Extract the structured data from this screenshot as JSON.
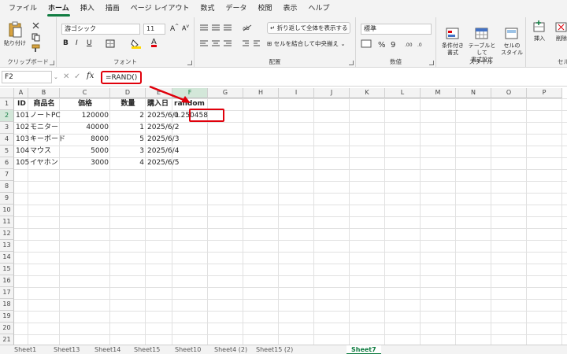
{
  "menu": [
    "ファイル",
    "ホーム",
    "挿入",
    "描画",
    "ページ レイアウト",
    "数式",
    "データ",
    "校閲",
    "表示",
    "ヘルプ"
  ],
  "ribbon": {
    "clipboard": {
      "paste_label": "貼り付け",
      "group_label": "クリップボード"
    },
    "font": {
      "font_name": "游ゴシック",
      "font_size": "11",
      "group_label": "フォント"
    },
    "alignment": {
      "wrap_label": "折り返して全体を表示する",
      "merge_label": "セルを結合して中央揃え",
      "group_label": "配置"
    },
    "number": {
      "format": "標準",
      "group_label": "数値"
    },
    "styles": {
      "cond_label": "条件付き\n書式",
      "table_label": "テーブルとして\n書式設定",
      "cell_label": "セルの\nスタイル",
      "group_label": "スタイル"
    },
    "cells": {
      "insert_label": "挿入",
      "delete_label": "削除",
      "group_label": "セル"
    }
  },
  "formula_bar": {
    "name_box": "F2",
    "fx": "fx",
    "formula": "=RAND()"
  },
  "columns": [
    "A",
    "B",
    "C",
    "D",
    "E",
    "F",
    "G",
    "H",
    "I",
    "J",
    "K",
    "L",
    "M",
    "N",
    "O",
    "P"
  ],
  "row_numbers": [
    "1",
    "2",
    "3",
    "4",
    "5",
    "6",
    "7",
    "8",
    "9",
    "10",
    "11",
    "12",
    "13",
    "14",
    "15",
    "16",
    "17",
    "18",
    "19",
    "20",
    "21"
  ],
  "table": {
    "headers": [
      "ID",
      "商品名",
      "価格",
      "数量",
      "購入日",
      "random"
    ],
    "rows": [
      [
        "101",
        "ノートPC",
        "120000",
        "2",
        "2025/6/1",
        "0.250458"
      ],
      [
        "102",
        "モニター",
        "40000",
        "1",
        "2025/6/2",
        ""
      ],
      [
        "103",
        "キーボード",
        "8000",
        "5",
        "2025/6/3",
        ""
      ],
      [
        "104",
        "マウス",
        "5000",
        "3",
        "2025/6/4",
        ""
      ],
      [
        "105",
        "イヤホン",
        "3000",
        "4",
        "2025/6/5",
        ""
      ]
    ]
  },
  "sheet_tabs": [
    "Sheet1",
    "Sheet13",
    "Sheet14",
    "Sheet15",
    "Sheet10",
    "Sheet4 (2)",
    "Sheet15 (2)",
    "Sheet7"
  ],
  "active_tab": "Sheet7",
  "colors": {
    "accent": "#107c41",
    "highlight": "#e0000b"
  }
}
